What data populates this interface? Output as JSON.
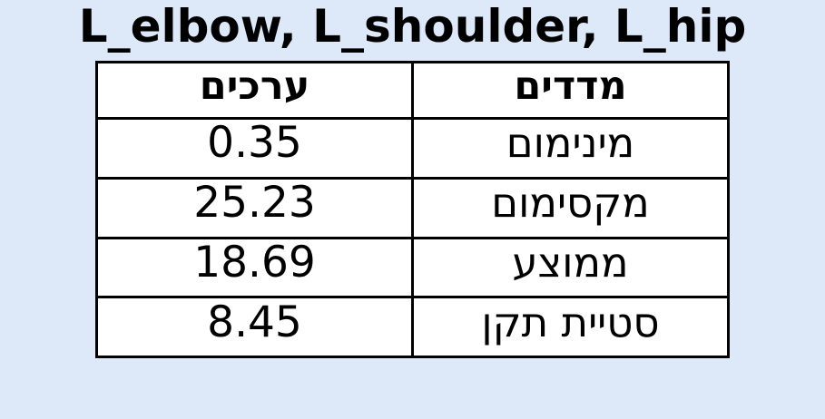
{
  "chart_data": {
    "type": "table",
    "title": "L_elbow, L_shoulder, L_hip",
    "columns": [
      "ערכים",
      "מדדים"
    ],
    "rows": [
      {
        "value": "0.35",
        "metric": "מינימום"
      },
      {
        "value": "25.23",
        "metric": "מקסימום"
      },
      {
        "value": "18.69",
        "metric": "ממוצע"
      },
      {
        "value": "8.45",
        "metric": "סטיית תקן"
      }
    ]
  },
  "colors": {
    "background": "#dde8f8",
    "table_background": "#ffffff",
    "border": "#000000",
    "text": "#000000"
  }
}
